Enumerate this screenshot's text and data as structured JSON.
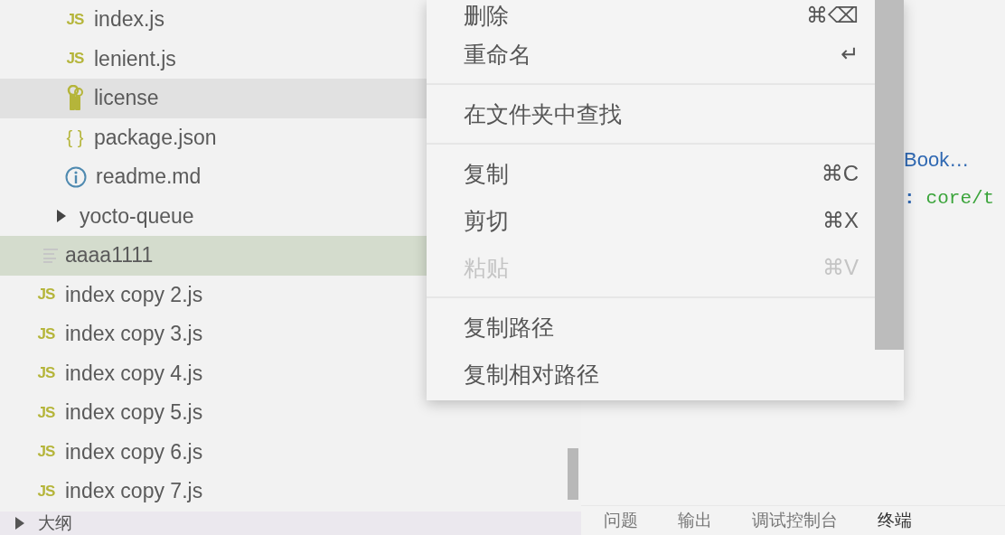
{
  "sidebar": {
    "tree": [
      {
        "children": [
          {
            "children": [
              {
                "name": "index.js",
                "kind": "js",
                "type_label": "JS",
                "selected": false,
                "hovered": false
              },
              {
                "name": "lenient.js",
                "kind": "js",
                "type_label": "JS",
                "selected": false,
                "hovered": false
              },
              {
                "name": "license",
                "kind": "license",
                "selected": false,
                "hovered": true
              },
              {
                "name": "package.json",
                "kind": "json",
                "type_label": "{ }",
                "selected": false,
                "hovered": false
              },
              {
                "name": "readme.md",
                "kind": "info",
                "selected": false,
                "hovered": false
              }
            ]
          },
          {
            "name": "yocto-queue",
            "kind": "folder",
            "expanded": false,
            "selected": false,
            "hovered": false
          }
        ]
      },
      {
        "name": "aaaa1111",
        "kind": "text",
        "selected": true,
        "hovered": false
      },
      {
        "name": "index copy 2.js",
        "kind": "js",
        "type_label": "JS",
        "selected": false,
        "hovered": false
      },
      {
        "name": "index copy 3.js",
        "kind": "js",
        "type_label": "JS",
        "selected": false,
        "hovered": false
      },
      {
        "name": "index copy 4.js",
        "kind": "js",
        "type_label": "JS",
        "selected": false,
        "hovered": false
      },
      {
        "name": "index copy 5.js",
        "kind": "js",
        "type_label": "JS",
        "selected": false,
        "hovered": false
      },
      {
        "name": "index copy 6.js",
        "kind": "js",
        "type_label": "JS",
        "selected": false,
        "hovered": false
      },
      {
        "name": "index copy 7.js",
        "kind": "js",
        "type_label": "JS",
        "selected": false,
        "hovered": false
      }
    ],
    "outline": {
      "label": "大纲",
      "expanded": false
    }
  },
  "context_menu": {
    "items": [
      {
        "kind": "item",
        "label": "删除",
        "shortcut": "⌘⌫",
        "disabled": false
      },
      {
        "kind": "item",
        "label": "重命名",
        "shortcut": "↵",
        "disabled": false
      },
      {
        "kind": "separator"
      },
      {
        "kind": "item",
        "label": "在文件夹中查找",
        "disabled": false
      },
      {
        "kind": "separator"
      },
      {
        "kind": "item",
        "label": "复制",
        "shortcut": "⌘C",
        "disabled": false
      },
      {
        "kind": "item",
        "label": "剪切",
        "shortcut": "⌘X",
        "disabled": false
      },
      {
        "kind": "item",
        "label": "粘贴",
        "shortcut": "⌘V",
        "disabled": true
      },
      {
        "kind": "separator"
      },
      {
        "kind": "item",
        "label": "复制路径",
        "disabled": false
      },
      {
        "kind": "item",
        "label": "复制相对路径",
        "disabled": false
      }
    ]
  },
  "editor": {
    "lines": [
      [
        {
          "kind": "link",
          "text": "Book…"
        }
      ],
      [
        {
          "kind": "punct",
          "text": ":"
        },
        {
          "kind": "string",
          "text": "core/t"
        }
      ]
    ]
  },
  "panel": {
    "tabs": [
      {
        "label": "问题",
        "selected": false
      },
      {
        "label": "输出",
        "selected": false
      },
      {
        "label": "调试控制台",
        "selected": false
      },
      {
        "label": "终端",
        "selected": true
      }
    ]
  }
}
